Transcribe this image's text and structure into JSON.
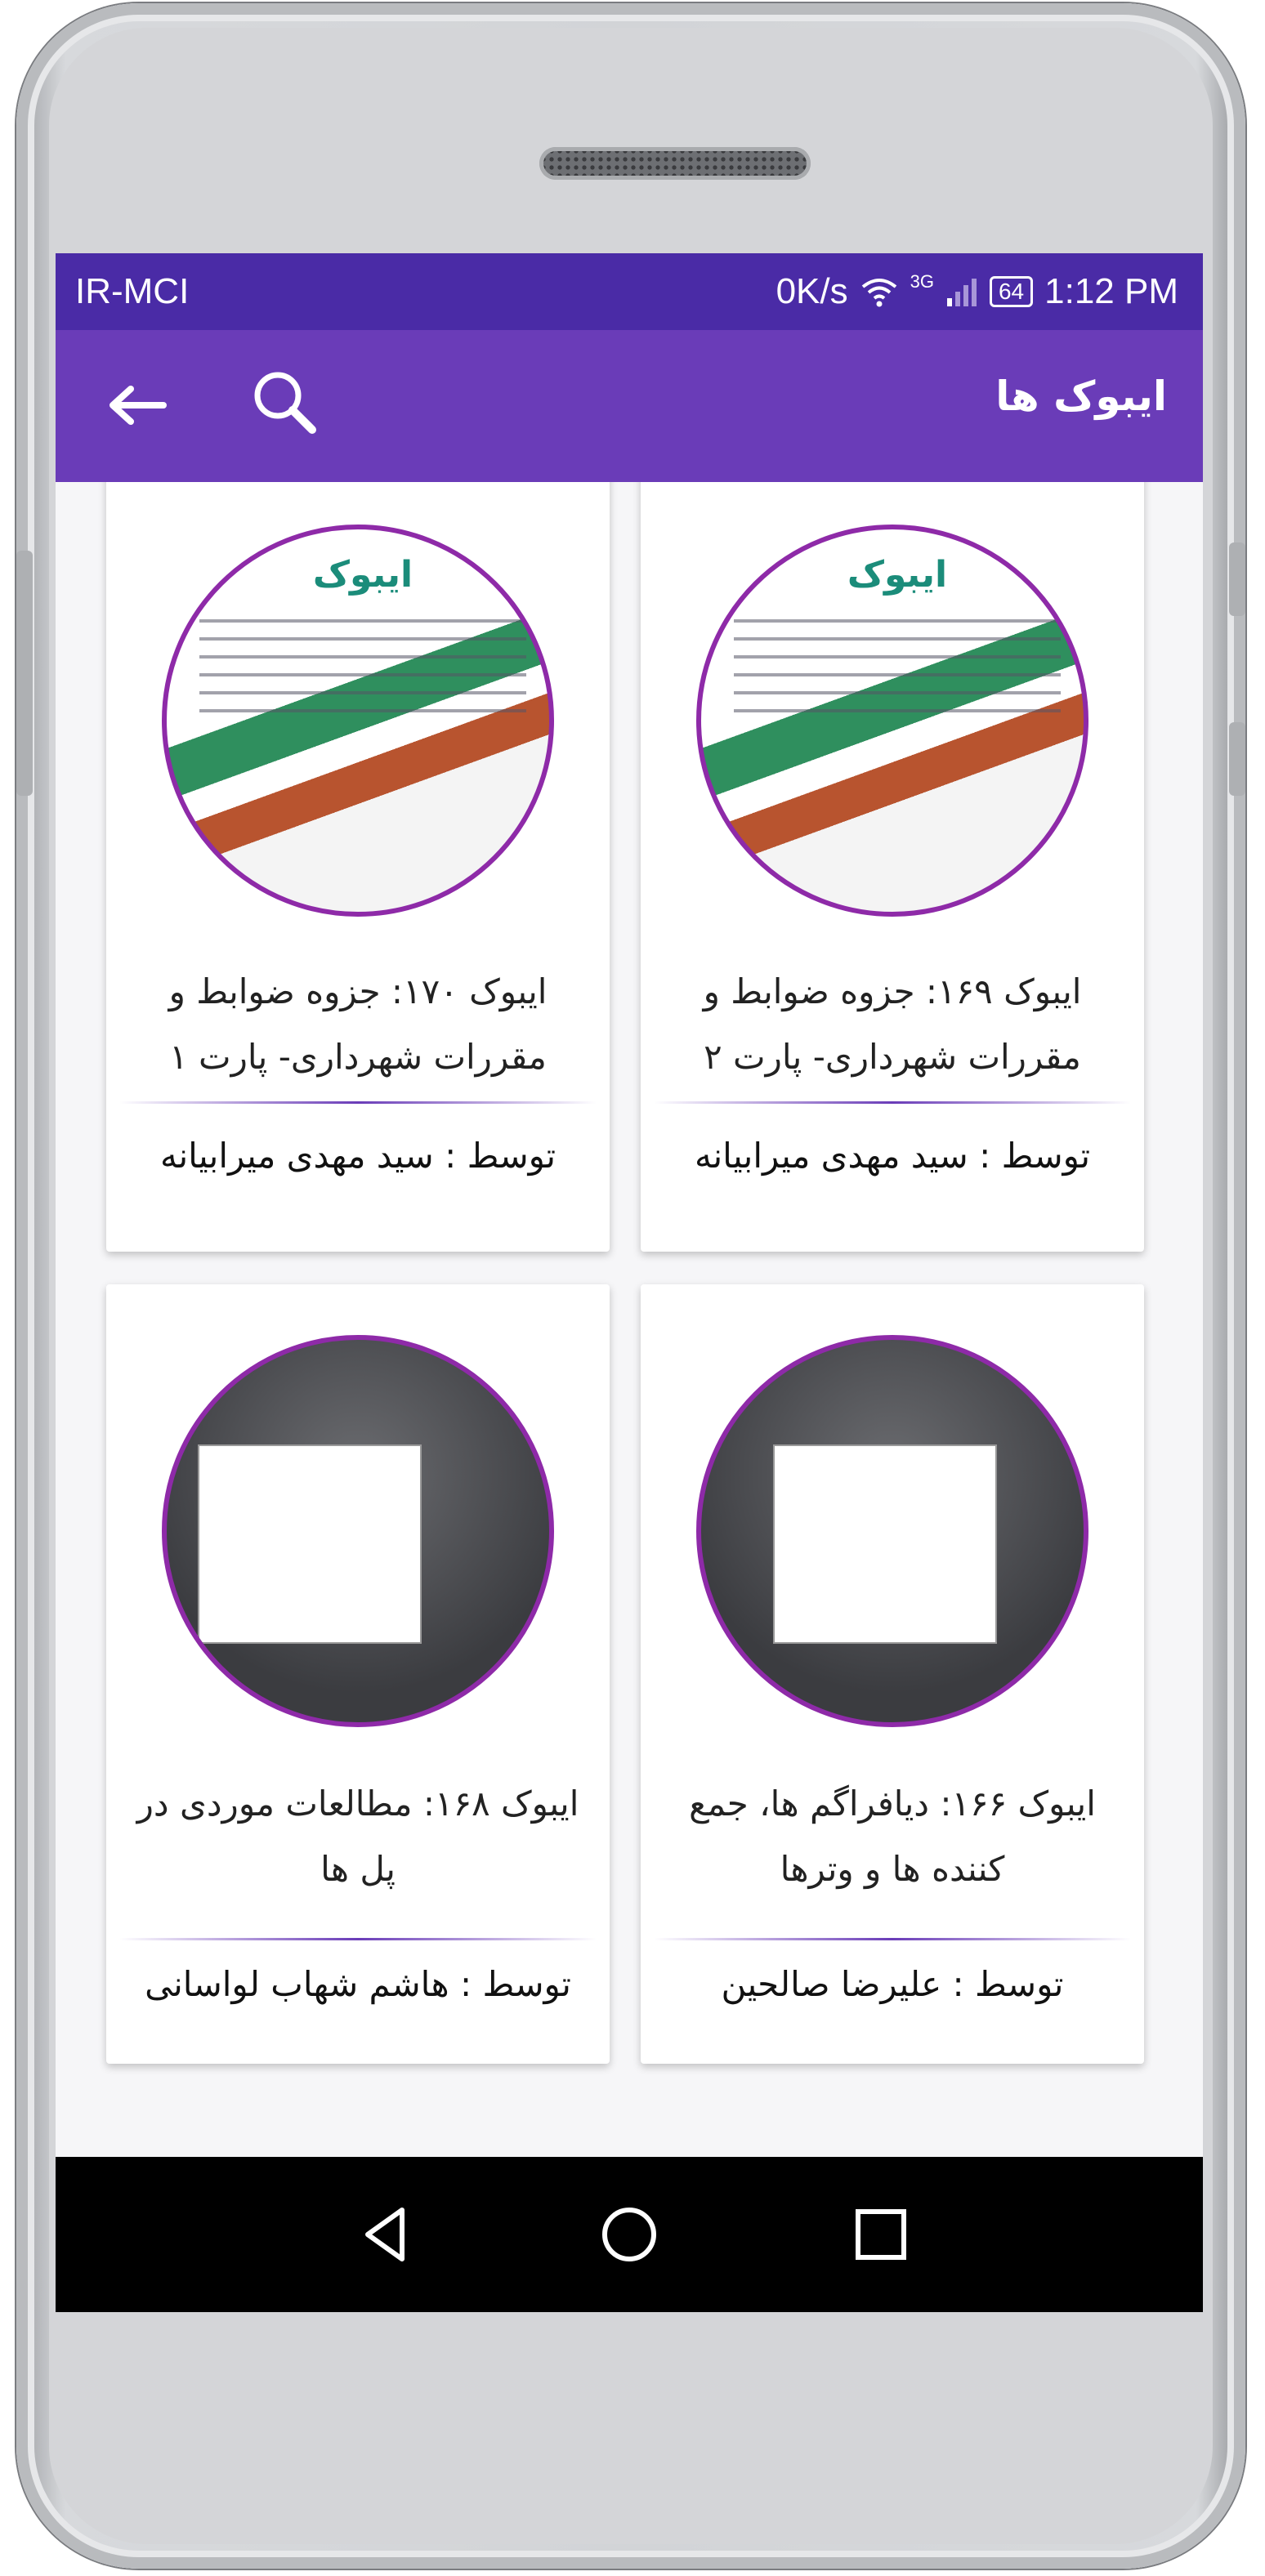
{
  "status_bar": {
    "carrier": "IR-MCI",
    "speed": "0K/s",
    "network": "3G",
    "battery": "64",
    "time": "1:12 PM"
  },
  "app_bar": {
    "title": "ایبوک ها"
  },
  "books": [
    {
      "title_line1": "ایبوک ۱۶۹: جزوه ضوابط و",
      "title_line2": "مقررات شهرداری- پارت ۲",
      "author": "توسط : سید مهدی میرابیانه",
      "cover_logo": "ایبوک",
      "cover_style": "light"
    },
    {
      "title_line1": "ایبوک ۱۷۰: جزوه ضوابط و",
      "title_line2": "مقررات شهرداری- پارت ۱",
      "author": "توسط : سید مهدی میرابیانه",
      "cover_logo": "ایبوک",
      "cover_style": "light"
    },
    {
      "title_line1": "ایبوک ۱۶۶: دیافراگم ها، جمع",
      "title_line2": "کننده ها و وترها",
      "author": "توسط : علیرضا صالحین",
      "cover_style": "dark"
    },
    {
      "title_line1": "ایبوک ۱۶۸: مطالعات موردی در",
      "title_line2": "پل ها",
      "author": "توسط : هاشم شهاب لواسانی",
      "cover_style": "dark"
    }
  ],
  "colors": {
    "status_bar": "#4a2ba6",
    "app_bar": "#6a3cb8",
    "cover_ring": "#8e2aa8"
  },
  "icons": [
    "back-arrow-icon",
    "search-icon",
    "nav-back-icon",
    "nav-home-icon",
    "nav-recents-icon",
    "wifi-icon",
    "signal-icon",
    "battery-icon"
  ]
}
